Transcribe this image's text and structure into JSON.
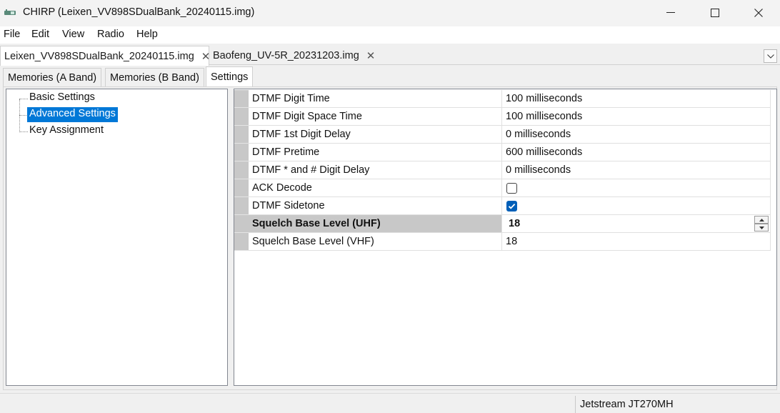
{
  "window": {
    "title": "CHIRP (Leixen_VV898SDualBank_20240115.img)"
  },
  "menu": [
    "File",
    "Edit",
    "View",
    "Radio",
    "Help"
  ],
  "file_tabs": [
    {
      "label": "Leixen_VV898SDualBank_20240115.img",
      "close": "✕",
      "active": true
    },
    {
      "label": "Baofeng_UV-5R_20231203.img",
      "close": "✕",
      "active": false
    }
  ],
  "sub_tabs": [
    {
      "label": "Memories (A Band)",
      "active": false
    },
    {
      "label": "Memories (B Band)",
      "active": false
    },
    {
      "label": "Settings",
      "active": true
    }
  ],
  "tree": [
    {
      "label": "Basic Settings",
      "selected": false
    },
    {
      "label": "Advanced Settings",
      "selected": true
    },
    {
      "label": "Key Assignment",
      "selected": false
    }
  ],
  "settings": [
    {
      "name": "DTMF Digit Time",
      "value": "100 milliseconds"
    },
    {
      "name": "DTMF Digit Space Time",
      "value": "100 milliseconds"
    },
    {
      "name": "DTMF 1st Digit Delay",
      "value": "0 milliseconds"
    },
    {
      "name": "DTMF Pretime",
      "value": "600 milliseconds"
    },
    {
      "name": "DTMF * and # Digit Delay",
      "value": "0 milliseconds"
    },
    {
      "name": "ACK Decode",
      "checked": false
    },
    {
      "name": "DTMF Sidetone",
      "checked": true
    },
    {
      "name": "Squelch Base Level (UHF)",
      "value": "18"
    },
    {
      "name": "Squelch Base Level (VHF)",
      "value": "18"
    }
  ],
  "status": {
    "radio": "Jetstream JT270MH"
  },
  "colors": {
    "selection": "#0078d7",
    "checkbox_checked": "#005fb8",
    "row_header": "#c8c8c8"
  }
}
